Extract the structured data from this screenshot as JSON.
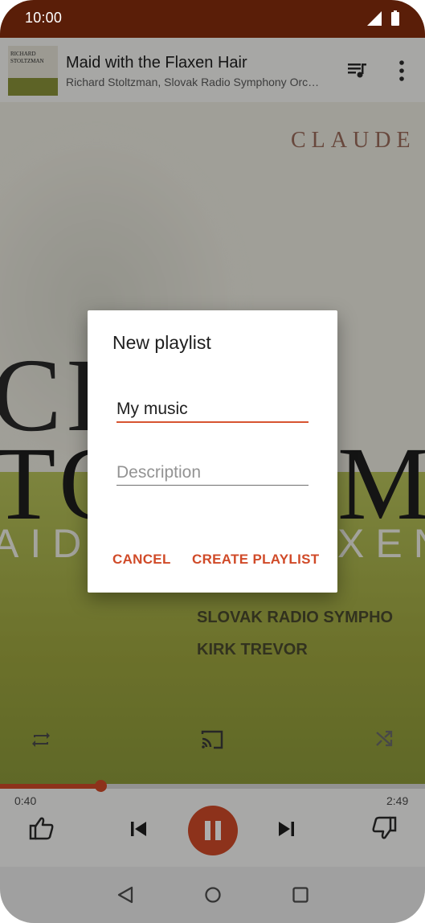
{
  "status_bar": {
    "time": "10:00"
  },
  "now_playing": {
    "title": "Maid with the Flaxen Hair",
    "artist": "Richard Stoltzman, Slovak Radio Symphony Orc…",
    "thumb_line1": "RICHARD",
    "thumb_line2": "STOLTZMAN"
  },
  "album_art": {
    "text_top": "CLAUDE",
    "text_big1": "CH",
    "text_big2": "TO",
    "text_big3": "M",
    "text_maid": "AID",
    "text_xen": "XEN",
    "credit1": "SLOVAK RADIO SYMPHO",
    "credit2": "KIRK TREVOR"
  },
  "player": {
    "elapsed": "0:40",
    "total": "2:49",
    "progress_fraction": 0.237
  },
  "dialog": {
    "title": "New playlist",
    "name_value": "My music",
    "description_placeholder": "Description",
    "cancel_label": "CANCEL",
    "create_label": "CREATE PLAYLIST"
  },
  "colors": {
    "accent": "#d04a28",
    "status_bar": "#5a1e08"
  }
}
